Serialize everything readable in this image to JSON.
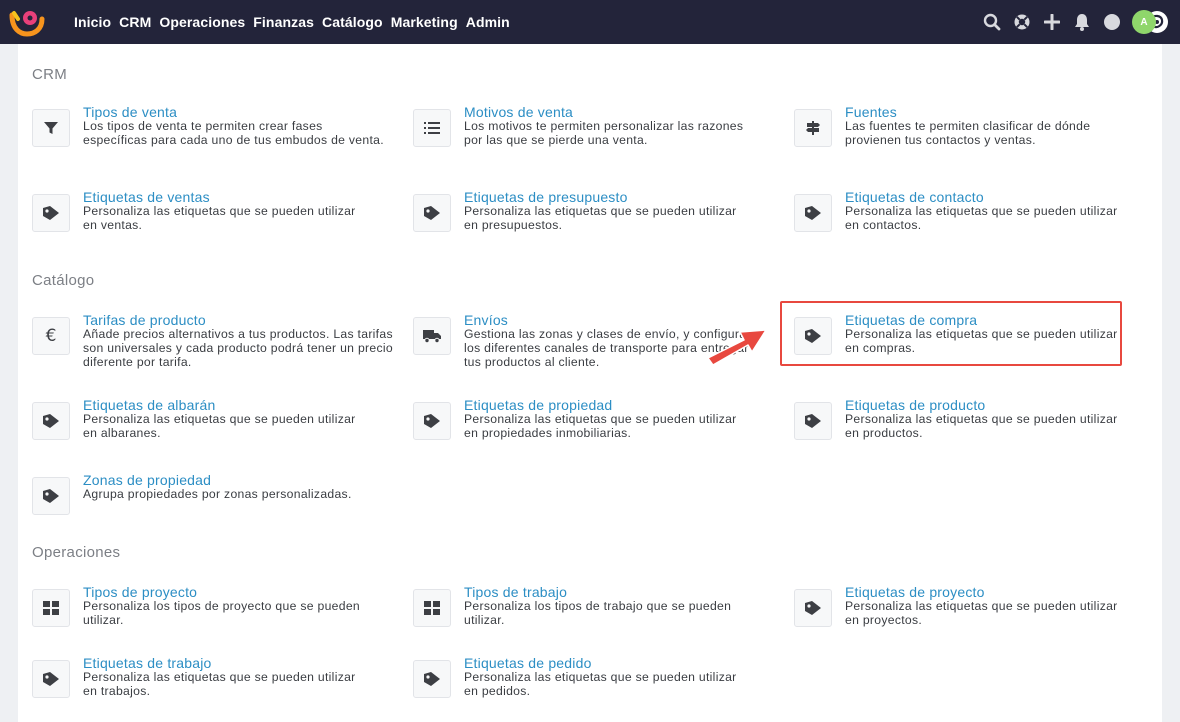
{
  "nav": {
    "items": [
      "Inicio",
      "CRM",
      "Operaciones",
      "Finanzas",
      "Catálogo",
      "Marketing",
      "Admin"
    ],
    "avatar_letter": "A"
  },
  "icons": {
    "top": [
      "search-icon",
      "lifebuoy-icon",
      "plus-icon",
      "bell-icon",
      "status-dot-icon"
    ],
    "cards": [
      "filter-icon",
      "list-icon",
      "signpost-icon",
      "tag-icon",
      "euro-icon",
      "truck-icon",
      "grid-icon"
    ]
  },
  "colors": {
    "topbar": "#23243a",
    "link": "#2c8ec4",
    "highlight": "#e8483f",
    "avatar": "#8fd66b"
  },
  "sections": {
    "crm": {
      "title": "CRM",
      "cards": [
        {
          "title": "Tipos de venta",
          "desc": "Los tipos de venta te permiten crear fases específicas para cada uno de tus embudos de venta."
        },
        {
          "title": "Motivos de venta",
          "desc": "Los motivos te permiten personalizar las razones por las que se pierde una venta."
        },
        {
          "title": "Fuentes",
          "desc": "Las fuentes te permiten clasificar de dónde provienen tus contactos y ventas."
        },
        {
          "title": "Etiquetas de ventas",
          "desc": "Personaliza las etiquetas que se pueden utilizar en ventas."
        },
        {
          "title": "Etiquetas de presupuesto",
          "desc": "Personaliza las etiquetas que se pueden utilizar en presupuestos."
        },
        {
          "title": "Etiquetas de contacto",
          "desc": "Personaliza las etiquetas que se pueden utilizar en contactos."
        }
      ]
    },
    "catalogo": {
      "title": "Catálogo",
      "cards": [
        {
          "title": "Tarifas de producto",
          "desc": "Añade precios alternativos a tus productos. Las tarifas son universales y cada producto podrá tener un precio diferente por tarifa."
        },
        {
          "title": "Envíos",
          "desc": "Gestiona las zonas y clases de envío, y configura los diferentes canales de transporte para entregar tus productos al cliente."
        },
        {
          "title": "Etiquetas de compra",
          "desc": "Personaliza las etiquetas que se pueden utilizar en compras."
        },
        {
          "title": "Etiquetas de albarán",
          "desc": "Personaliza las etiquetas que se pueden utilizar en albaranes."
        },
        {
          "title": "Etiquetas de propiedad",
          "desc": "Personaliza las etiquetas que se pueden utilizar en propiedades inmobiliarias."
        },
        {
          "title": "Etiquetas de producto",
          "desc": "Personaliza las etiquetas que se pueden utilizar en productos."
        },
        {
          "title": "Zonas de propiedad",
          "desc": "Agrupa propiedades por zonas personalizadas."
        }
      ]
    },
    "operaciones": {
      "title": "Operaciones",
      "cards": [
        {
          "title": "Tipos de proyecto",
          "desc": "Personaliza los tipos de proyecto que se pueden utilizar."
        },
        {
          "title": "Tipos de trabajo",
          "desc": "Personaliza los tipos de trabajo que se pueden utilizar."
        },
        {
          "title": "Etiquetas de proyecto",
          "desc": "Personaliza las etiquetas que se pueden utilizar en proyectos."
        },
        {
          "title": "Etiquetas de trabajo",
          "desc": "Personaliza las etiquetas que se pueden utilizar en trabajos."
        },
        {
          "title": "Etiquetas de pedido",
          "desc": "Personaliza las etiquetas que se pueden utilizar en pedidos."
        }
      ]
    }
  }
}
